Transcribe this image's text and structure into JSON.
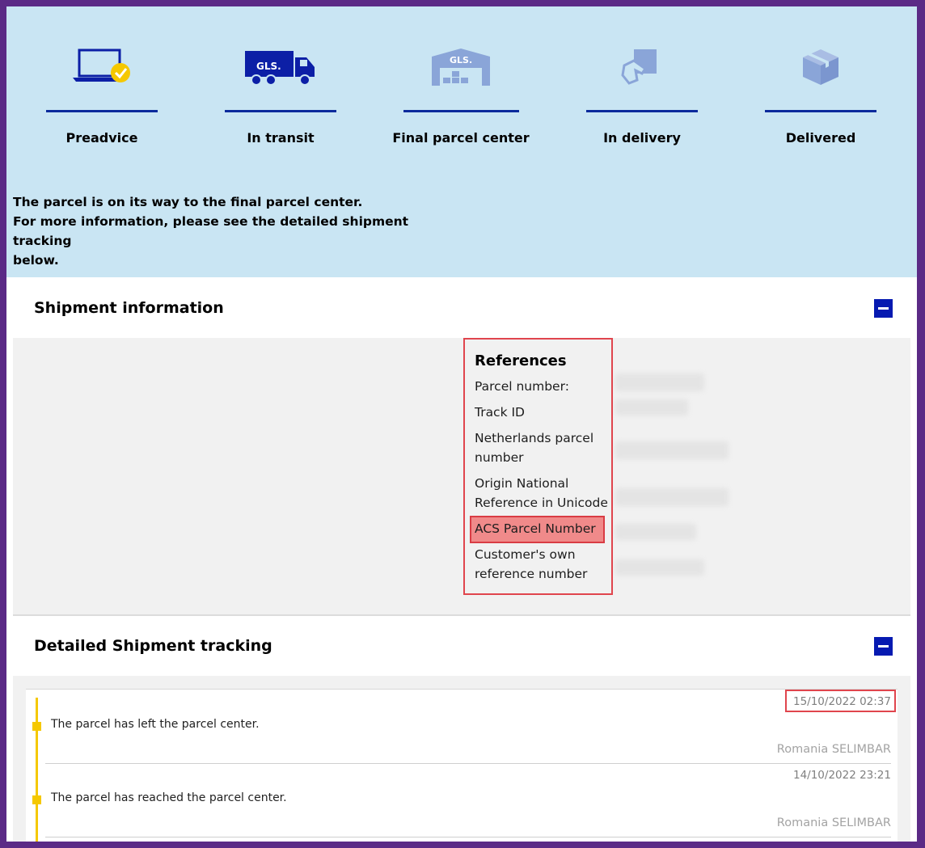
{
  "steps": [
    {
      "label": "Preadvice",
      "icon": "laptop-check-icon"
    },
    {
      "label": "In transit",
      "icon": "truck-icon"
    },
    {
      "label": "Final parcel center",
      "icon": "warehouse-icon"
    },
    {
      "label": "In delivery",
      "icon": "hand-parcel-icon"
    },
    {
      "label": "Delivered",
      "icon": "box-icon"
    }
  ],
  "brand_text": "GLS.",
  "status_message": {
    "line1": "The parcel is on its way to the final parcel center.",
    "line2": "For more information, please see the detailed shipment tracking",
    "line3": "below."
  },
  "shipment_info": {
    "title": "Shipment information",
    "references_title": "References",
    "references": [
      [
        "Parcel number:"
      ],
      [
        "Track ID"
      ],
      [
        "Netherlands parcel",
        "number"
      ],
      [
        "Origin National",
        "Reference in Unicode"
      ],
      [
        "ACS Parcel Number"
      ],
      [
        "Customer's own",
        "reference number"
      ]
    ]
  },
  "tracking": {
    "title": "Detailed Shipment tracking",
    "events": [
      {
        "time": "15/10/2022 02:37",
        "description": "The parcel has left the parcel center.",
        "location": "Romania SELIMBAR"
      },
      {
        "time": "14/10/2022 23:21",
        "description": "The parcel has reached the parcel center.",
        "location": "Romania SELIMBAR"
      }
    ]
  },
  "colors": {
    "brand_blue": "#061ab1",
    "panel_bg": "#c9e5f3",
    "highlight_red": "#e0454d",
    "timeline_yellow": "#f5c800"
  }
}
